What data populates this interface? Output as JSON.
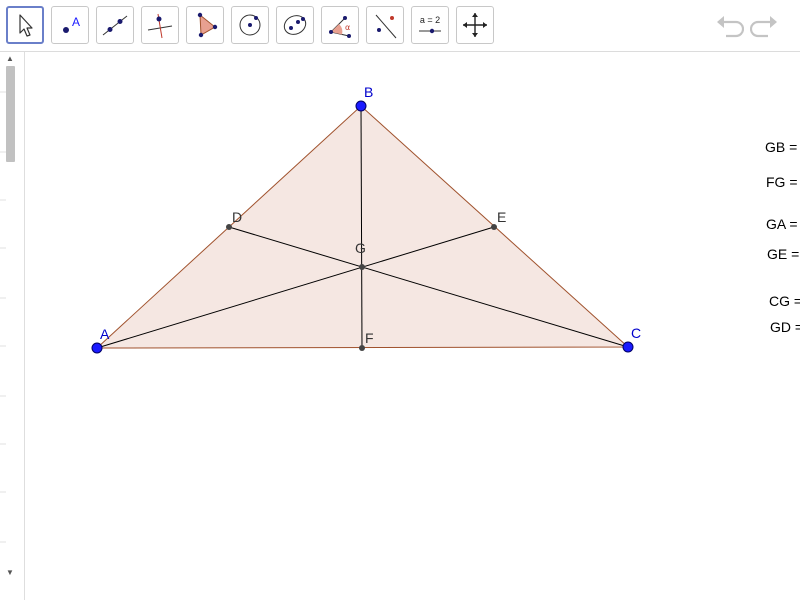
{
  "toolbar": {
    "tools": [
      {
        "name": "Move",
        "icon": "arrow-cursor-icon"
      },
      {
        "name": "Point",
        "icon": "point-icon",
        "glyph": "A"
      },
      {
        "name": "Line",
        "icon": "line-icon"
      },
      {
        "name": "Perpendicular Line",
        "icon": "perpendicular-line-icon"
      },
      {
        "name": "Polygon",
        "icon": "polygon-icon"
      },
      {
        "name": "Circle with Center through Point",
        "icon": "circle-center-point-icon"
      },
      {
        "name": "Ellipse",
        "icon": "ellipse-icon"
      },
      {
        "name": "Angle",
        "icon": "angle-icon",
        "glyph": "α"
      },
      {
        "name": "Reflect about Line",
        "icon": "reflect-icon"
      },
      {
        "name": "Slider",
        "icon": "slider-icon",
        "glyph": "a = 2"
      },
      {
        "name": "Move Graphics View",
        "icon": "move-view-icon"
      }
    ],
    "selected_index": 0
  },
  "colors": {
    "point_blue": "#1a1aff",
    "label_blue": "#0000cc",
    "triangle_edge": "#a0522d",
    "triangle_fill": "#f5e7e2",
    "median": "#000000",
    "small_point": "#444444",
    "selected_border": "#6a7fc9"
  },
  "construction": {
    "points": {
      "A": {
        "label": "A"
      },
      "B": {
        "label": "B"
      },
      "C": {
        "label": "C"
      },
      "D": {
        "label": "D"
      },
      "E": {
        "label": "E"
      },
      "F": {
        "label": "F"
      },
      "G": {
        "label": "G"
      }
    }
  },
  "measurements": [
    {
      "text": "GB ="
    },
    {
      "text": "FG ="
    },
    {
      "text": "GA ="
    },
    {
      "text": "GE ="
    },
    {
      "text": "CG ="
    },
    {
      "text": "GD ="
    }
  ]
}
